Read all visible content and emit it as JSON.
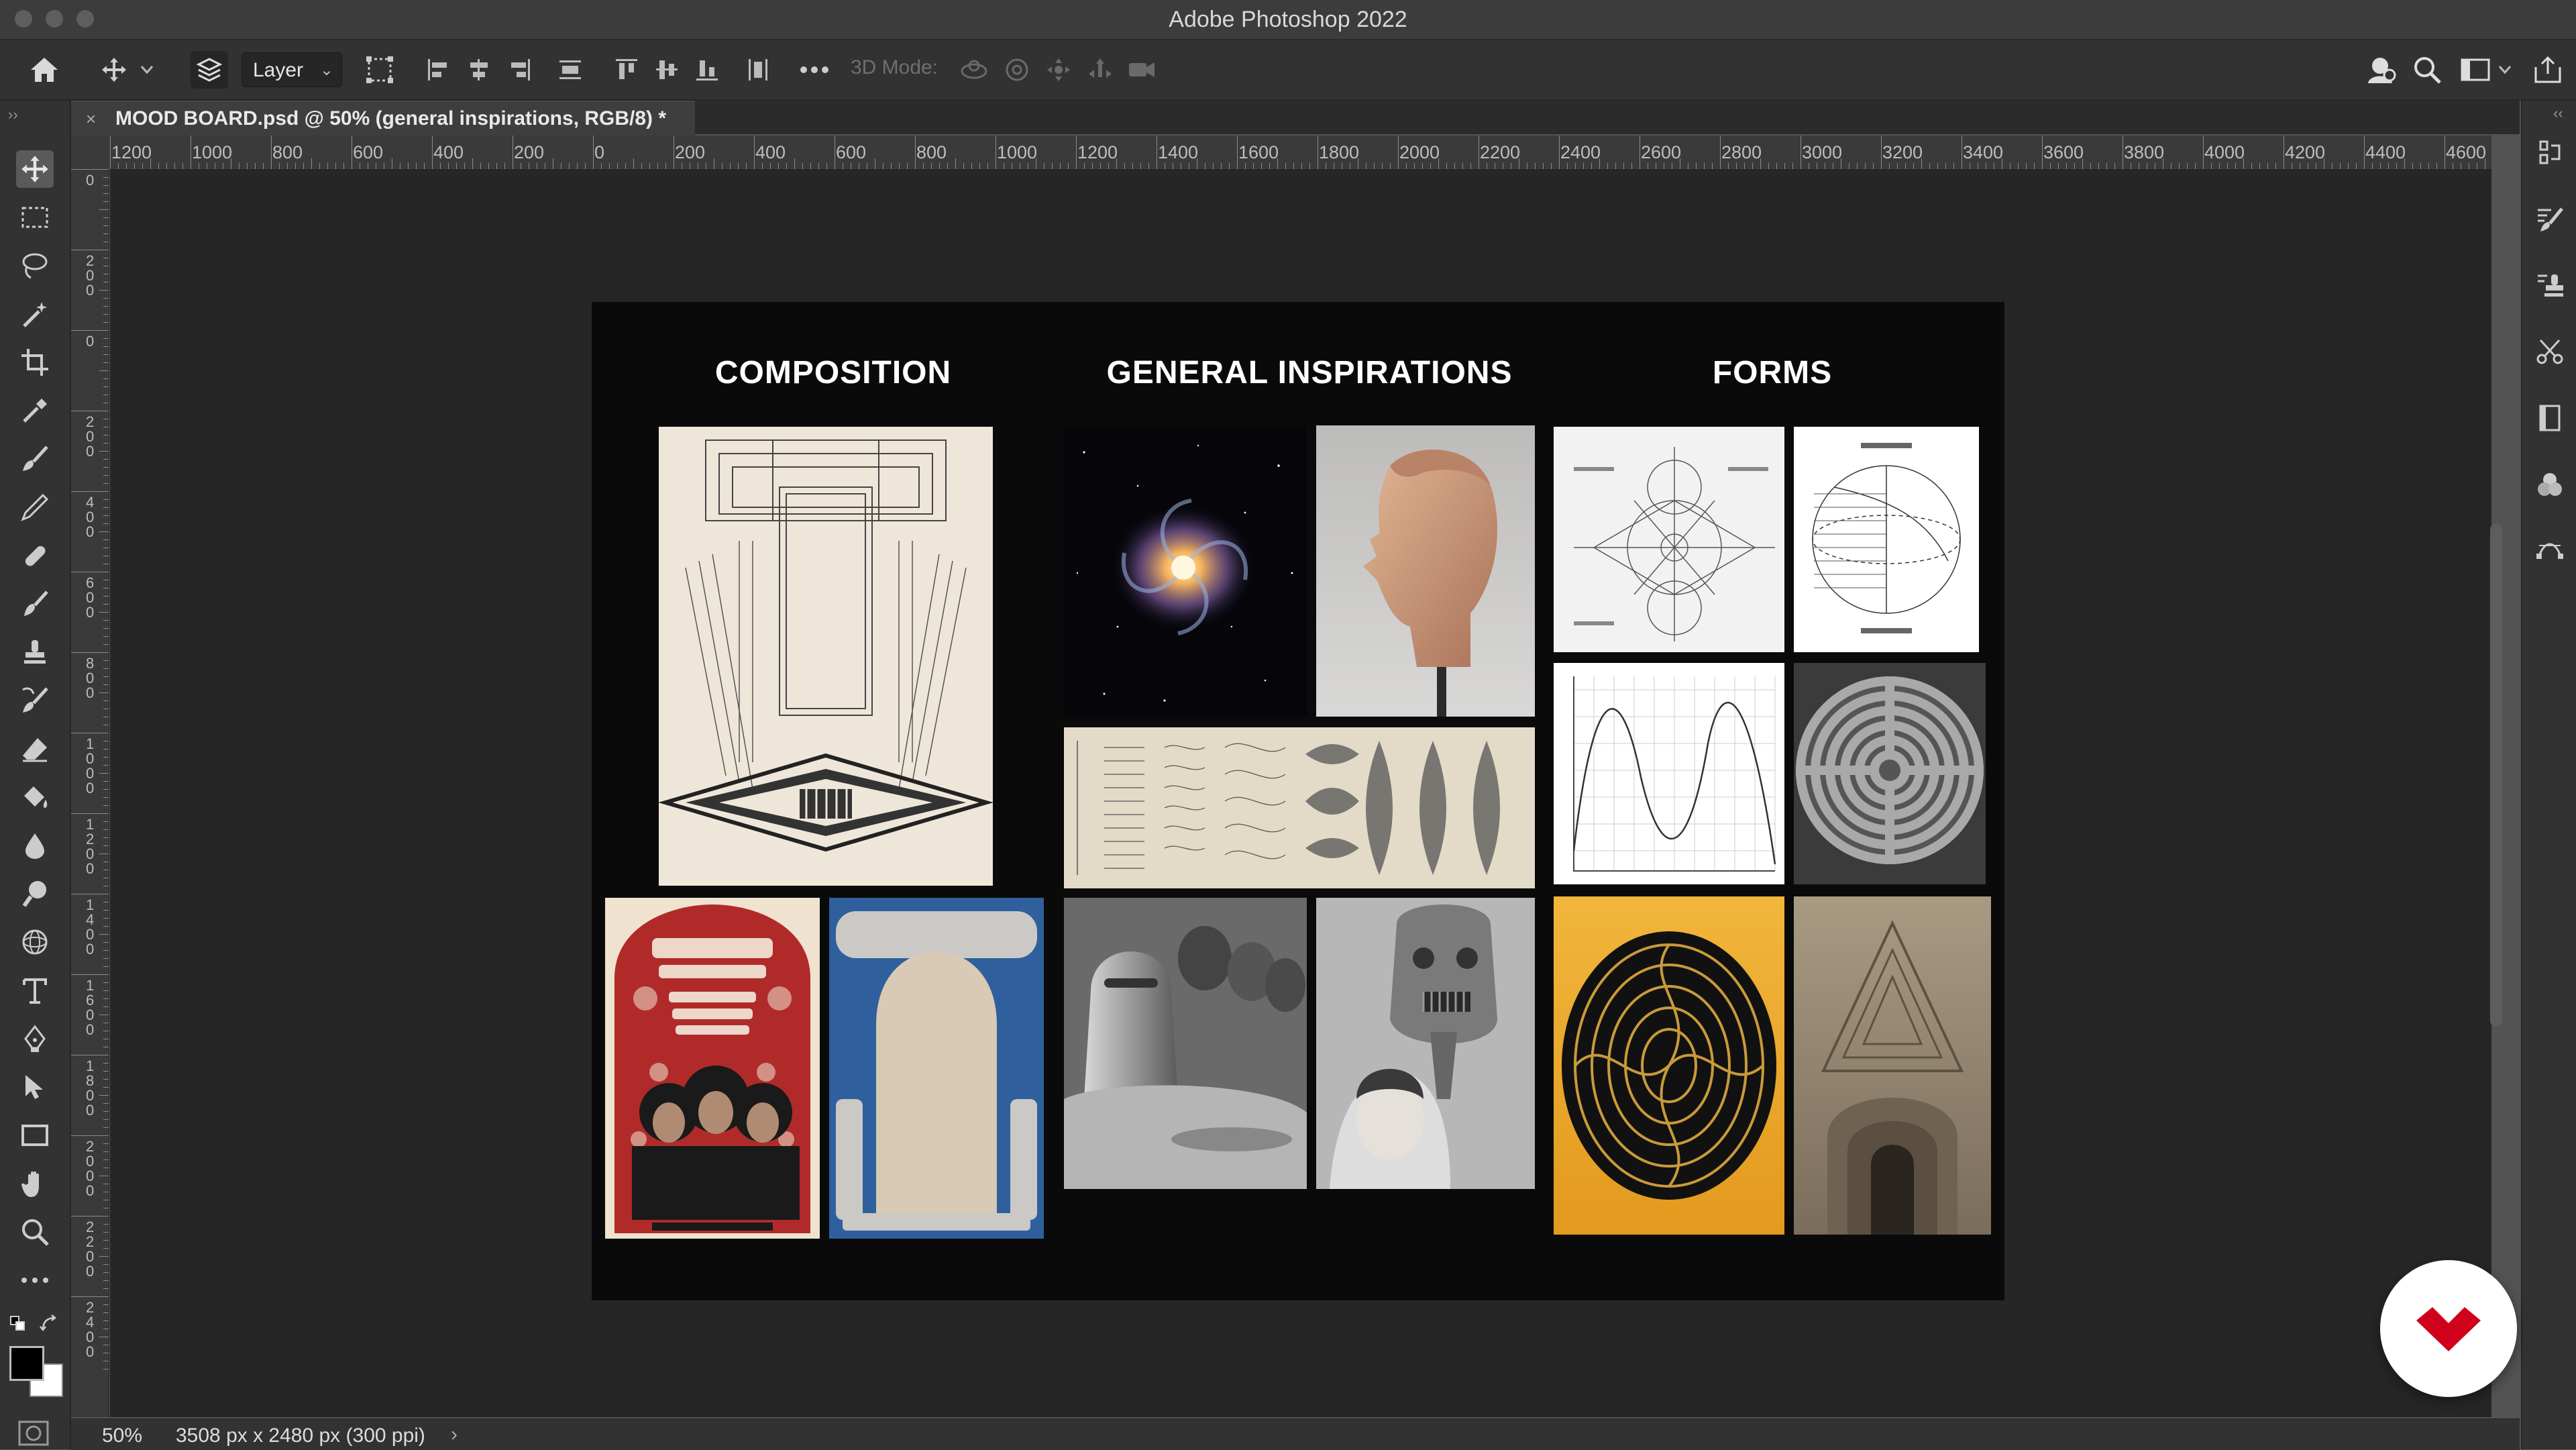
{
  "window": {
    "title": "Adobe Photoshop 2022"
  },
  "options_bar": {
    "layer_select": "Layer",
    "mode_3d_label": "3D Mode:"
  },
  "document_tab": {
    "close": "×",
    "title": "MOOD BOARD.psd @ 50% (general inspirations, RGB/8) *"
  },
  "ruler": {
    "horizontal_ticks": [
      "1200",
      "1000",
      "800",
      "600",
      "400",
      "200",
      "0",
      "200",
      "400",
      "600",
      "800",
      "1000",
      "1200",
      "1400",
      "1600",
      "1800",
      "2000",
      "2200",
      "2400",
      "2600",
      "2800",
      "3000",
      "3200",
      "3400",
      "3600",
      "3800",
      "4000",
      "4200",
      "4400",
      "4600"
    ],
    "vertical_ticks": [
      "0",
      "200",
      "0",
      "200",
      "400",
      "600",
      "800",
      "1000",
      "1200",
      "1400",
      "1600",
      "1800",
      "2000",
      "2200",
      "2400"
    ]
  },
  "moodboard": {
    "sections": [
      {
        "title": "COMPOSITION"
      },
      {
        "title": "GENERAL INSPIRATIONS"
      },
      {
        "title": "FORMS"
      }
    ]
  },
  "status_bar": {
    "zoom": "50%",
    "document_size": "3508 px x 2480 px (300 ppi)",
    "chevron": "›"
  },
  "colors": {
    "accent_badge": "#d0021b",
    "ui_dark": "#323232",
    "canvas_bg": "#262626"
  }
}
